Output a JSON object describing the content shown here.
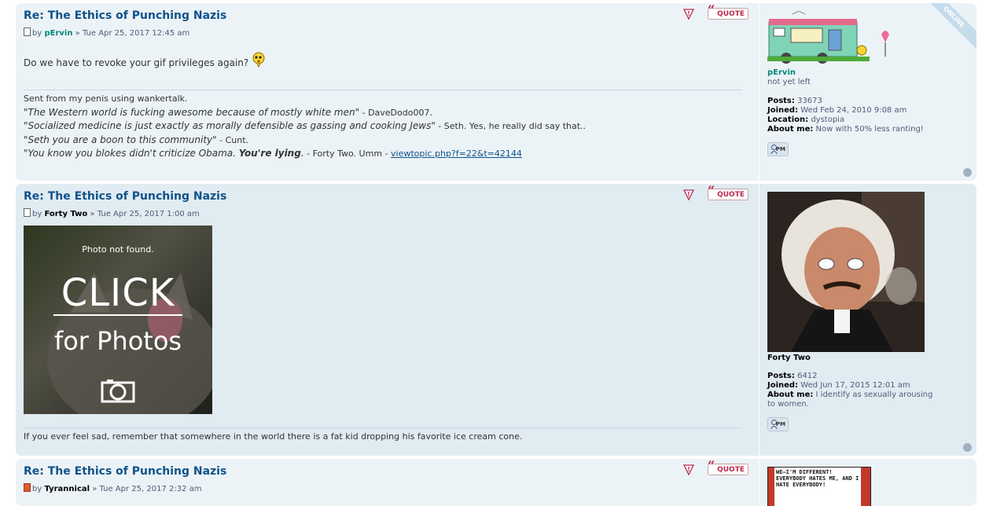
{
  "posts": [
    {
      "title": "Re: The Ethics of Punching Nazis",
      "by": "by",
      "author": "pErvin",
      "date": "» Tue Apr 25, 2017 12:45 am",
      "body": "Do we have to revoke your gif privileges again?",
      "sig": {
        "line1": "Sent from my penis using wankertalk.",
        "q1": "\"The Western world is fucking awesome because of mostly white men\"",
        "a1": " - DaveDodo007.",
        "q2": "\"Socialized medicine is just exactly as morally defensible as gassing and cooking Jews\"",
        "a2": " - Seth. Yes, he really did say that..",
        "q3": "\"Seth you are a boon to this community\"",
        "a3": " - Cunt.",
        "q4a": "\"You know you blokes didn't criticize Obama. ",
        "q4b": "You're lying",
        "q4c": ".",
        "a4": " - Forty Two. Umm - ",
        "link": "viewtopic.php?f=22&t=42144"
      },
      "quote_label": "QUOTE",
      "online_label": "ONLINE",
      "profile": {
        "name": "pErvin",
        "rank": "not yet left",
        "posts_label": "Posts:",
        "posts": "33673",
        "joined_label": "Joined:",
        "joined": "Wed Feb 24, 2010 9:08 am",
        "location_label": "Location:",
        "location": "dystopia",
        "about_label": "About me:",
        "about": "Now with 50% less ranting!"
      },
      "pm_label": "PM"
    },
    {
      "title": "Re: The Ethics of Punching Nazis",
      "by": "by",
      "author": "Forty Two",
      "date": "» Tue Apr 25, 2017 1:00 am",
      "photo": {
        "not_found": "Photo not found.",
        "click": "CLICK",
        "for_photos": "for Photos"
      },
      "sig": "If you ever feel sad, remember that somewhere in the world there is a fat kid dropping his favorite ice cream cone.",
      "quote_label": "QUOTE",
      "profile": {
        "name": "Forty Two",
        "posts_label": "Posts:",
        "posts": "6412",
        "joined_label": "Joined:",
        "joined": "Wed Jun 17, 2015 12:01 am",
        "about_label": "About me:",
        "about": "I identify as sexually arousing to women."
      },
      "pm_label": "PM"
    },
    {
      "title": "Re: The Ethics of Punching Nazis",
      "by": "by",
      "author": "Tyrannical",
      "date": "» Tue Apr 25, 2017 2:32 am",
      "quote_label": "QUOTE",
      "avatar_text": "WE—I'M DIFFERENT! EVERYBODY HATES ME, AND I HATE EVERYBODY!"
    }
  ],
  "colors": {
    "title": "#105289",
    "bg1": "#ecf3f7",
    "bg2": "#e1ebf2",
    "quote": "#bc2a4d",
    "author_teal": "#00877a"
  }
}
